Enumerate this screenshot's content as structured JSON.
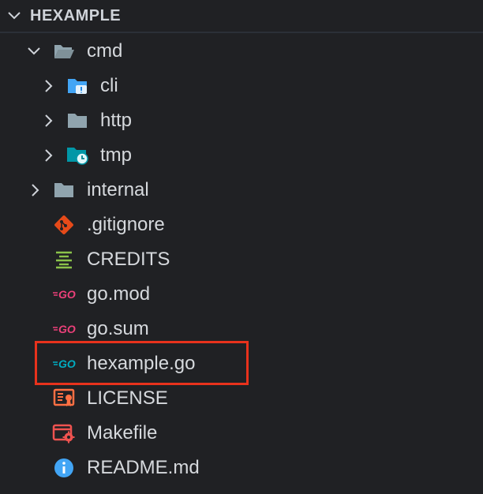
{
  "explorer": {
    "title": "HEXAMPLE",
    "items": [
      {
        "label": "cmd",
        "icon": "folder-open-icon"
      },
      {
        "label": "cli",
        "icon": "folder-cli-icon"
      },
      {
        "label": "http",
        "icon": "folder-icon"
      },
      {
        "label": "tmp",
        "icon": "folder-temp-icon"
      },
      {
        "label": "internal",
        "icon": "folder-icon"
      },
      {
        "label": ".gitignore",
        "icon": "git-icon"
      },
      {
        "label": "CREDITS",
        "icon": "text-lines-icon"
      },
      {
        "label": "go.mod",
        "icon": "go-mod-icon"
      },
      {
        "label": "go.sum",
        "icon": "go-sum-icon"
      },
      {
        "label": "hexample.go",
        "icon": "go-file-icon"
      },
      {
        "label": "LICENSE",
        "icon": "license-icon"
      },
      {
        "label": "Makefile",
        "icon": "makefile-icon"
      },
      {
        "label": "README.md",
        "icon": "info-icon"
      }
    ],
    "highlighted_item": "hexample.go"
  },
  "colors": {
    "folder": "#90a4ae",
    "folder_cli": "#42a5f5",
    "folder_temp": "#0097a7",
    "git": "#e64a19",
    "credits": "#8bc34a",
    "go_pink": "#ec407a",
    "go_teal": "#00acc1",
    "license": "#ff7043",
    "makefile": "#ef5350",
    "info": "#42a5f5",
    "highlight": "#e8321c"
  }
}
